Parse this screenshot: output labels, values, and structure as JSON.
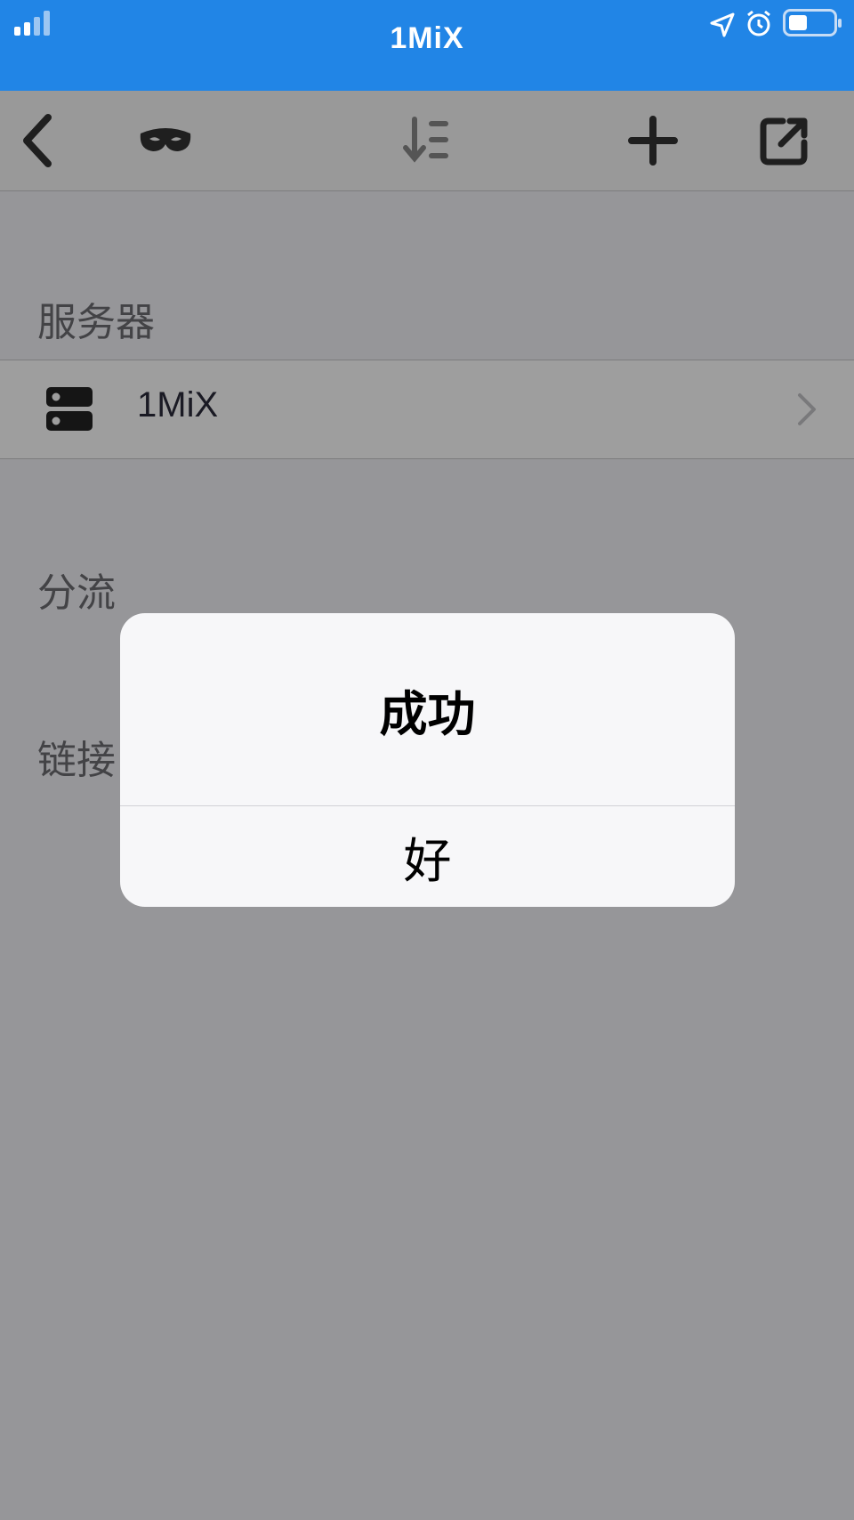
{
  "status_bar": {
    "title": "1MiX",
    "signal_icon": "signal-bars-icon",
    "location_icon": "location-arrow-icon",
    "alarm_icon": "alarm-clock-icon",
    "battery_icon": "battery-icon"
  },
  "toolbar": {
    "items": [
      {
        "icon": "back-chevron-icon"
      },
      {
        "icon": "mask-icon"
      },
      {
        "icon": "sort-icon"
      },
      {
        "icon": "plus-icon"
      },
      {
        "icon": "share-external-icon"
      }
    ]
  },
  "sections": {
    "servers_header": "服务器",
    "server_item": {
      "label": "1MiX",
      "icon": "server-icon"
    },
    "routing_header": "分流",
    "connection_header": "链接"
  },
  "alert": {
    "title": "成功",
    "ok_button": "好"
  }
}
